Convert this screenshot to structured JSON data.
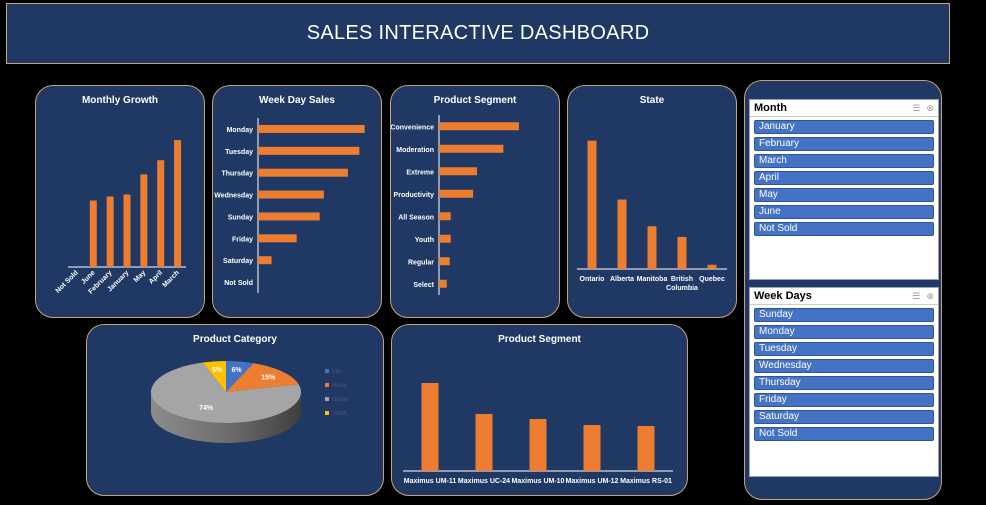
{
  "header": {
    "title": "SALES INTERACTIVE DASHBOARD"
  },
  "colors": {
    "bar": "#ed7d31",
    "panel": "#1f3864",
    "border": "#c9a27a",
    "axis": "#ffffff"
  },
  "charts": {
    "monthly_growth": {
      "type": "bar",
      "title": "Monthly Growth",
      "categories": [
        "Not Sold",
        "June",
        "February",
        "January",
        "May",
        "April",
        "March"
      ],
      "values": [
        0,
        33,
        35,
        36,
        46,
        53,
        63
      ],
      "ylim": [
        0,
        70
      ]
    },
    "weekday_sales": {
      "type": "bar",
      "orientation": "horizontal",
      "title": "Week Day Sales",
      "categories": [
        "Monday",
        "Tuesday",
        "Thursday",
        "Wednesday",
        "Sunday",
        "Friday",
        "Saturday",
        "Not Sold"
      ],
      "values": [
        102,
        97,
        86,
        63,
        59,
        37,
        13,
        0
      ],
      "xlim": [
        0,
        110
      ]
    },
    "product_segment_h": {
      "type": "bar",
      "orientation": "horizontal",
      "title": "Product Segment",
      "categories": [
        "Convenience",
        "Moderation",
        "Extreme",
        "Productivity",
        "All Season",
        "Youth",
        "Regular",
        "Select"
      ],
      "values": [
        82,
        66,
        39,
        35,
        12,
        12,
        11,
        8
      ],
      "xlim": [
        0,
        120
      ]
    },
    "state": {
      "type": "bar",
      "title": "State",
      "categories": [
        "Ontario",
        "Alberta",
        "Manitoba",
        "British Columbia",
        "Quebec"
      ],
      "values": [
        120,
        65,
        40,
        30,
        4
      ],
      "ylim": [
        0,
        130
      ]
    },
    "product_category": {
      "type": "pie",
      "title": "Product Category",
      "categories": [
        "Mix",
        "Rural",
        "Urban",
        "Youth"
      ],
      "values": [
        6,
        15,
        74,
        5
      ],
      "labels": [
        "6%",
        "15%",
        "74%",
        "5%"
      ],
      "colors": [
        "#4472c4",
        "#ed7d31",
        "#a5a5a5",
        "#ffc000"
      ]
    },
    "product_segment_v": {
      "type": "bar",
      "title": "Product Segment",
      "categories": [
        "Maximus UM-11",
        "Maximus UC-24",
        "Maximus UM-10",
        "Maximus UM-12",
        "Maximus RS-01"
      ],
      "values": [
        88,
        57,
        52,
        46,
        45
      ],
      "ylim": [
        0,
        100
      ]
    }
  },
  "chart_data": [
    {
      "type": "bar",
      "title": "Monthly Growth",
      "categories": [
        "Not Sold",
        "June",
        "February",
        "January",
        "May",
        "April",
        "March"
      ],
      "values": [
        0,
        33,
        35,
        36,
        46,
        53,
        63
      ]
    },
    {
      "type": "bar",
      "title": "Week Day Sales",
      "categories": [
        "Monday",
        "Tuesday",
        "Thursday",
        "Wednesday",
        "Sunday",
        "Friday",
        "Saturday",
        "Not Sold"
      ],
      "values": [
        102,
        97,
        86,
        63,
        59,
        37,
        13,
        0
      ]
    },
    {
      "type": "bar",
      "title": "Product Segment",
      "categories": [
        "Convenience",
        "Moderation",
        "Extreme",
        "Productivity",
        "All Season",
        "Youth",
        "Regular",
        "Select"
      ],
      "values": [
        82,
        66,
        39,
        35,
        12,
        12,
        11,
        8
      ]
    },
    {
      "type": "bar",
      "title": "State",
      "categories": [
        "Ontario",
        "Alberta",
        "Manitoba",
        "British Columbia",
        "Quebec"
      ],
      "values": [
        120,
        65,
        40,
        30,
        4
      ]
    },
    {
      "type": "pie",
      "title": "Product Category",
      "categories": [
        "Mix",
        "Rural",
        "Urban",
        "Youth"
      ],
      "values": [
        6,
        15,
        74,
        5
      ]
    },
    {
      "type": "bar",
      "title": "Product Segment",
      "categories": [
        "Maximus UM-11",
        "Maximus UC-24",
        "Maximus UM-10",
        "Maximus UM-12",
        "Maximus RS-01"
      ],
      "values": [
        88,
        57,
        52,
        46,
        45
      ]
    }
  ],
  "slicers": {
    "month": {
      "title": "Month",
      "items": [
        "January",
        "February",
        "March",
        "April",
        "May",
        "June",
        "Not Sold"
      ]
    },
    "weekdays": {
      "title": "Week Days",
      "items": [
        "Sunday",
        "Monday",
        "Tuesday",
        "Wednesday",
        "Thursday",
        "Friday",
        "Saturday",
        "Not Sold"
      ]
    }
  }
}
